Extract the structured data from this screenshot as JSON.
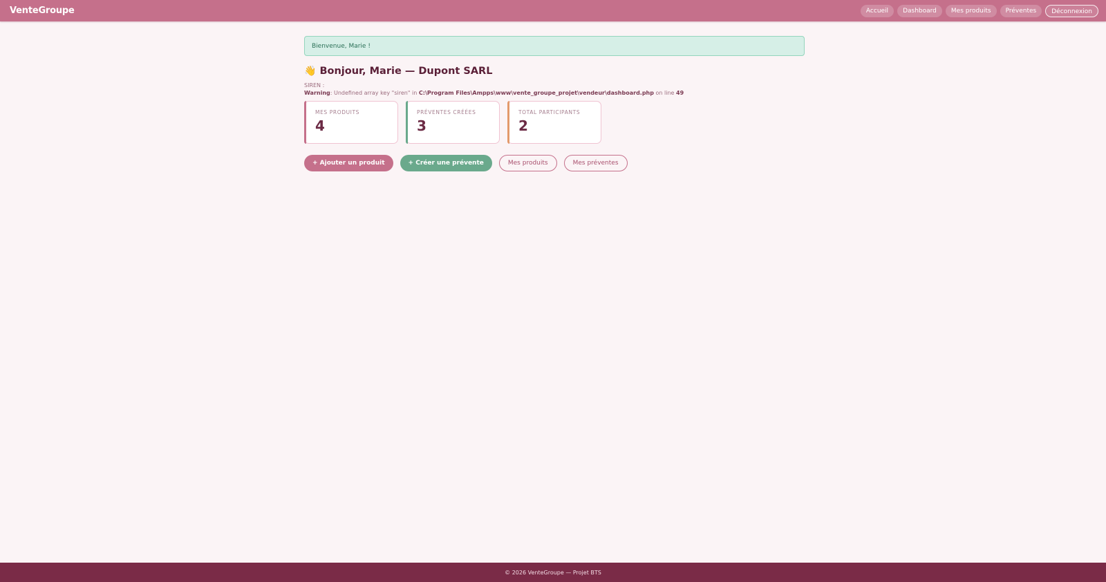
{
  "header": {
    "brand": "VenteGroupe",
    "nav": [
      "Accueil",
      "Dashboard",
      "Mes produits",
      "Préventes"
    ],
    "logout": "Déconnexion"
  },
  "flash": "Bienvenue, Marie !",
  "greeting": {
    "icon": "waving-hand-icon",
    "emoji": "👋",
    "text": "Bonjour, Marie — Dupont SARL"
  },
  "siren_label": "SIREN :",
  "warning": {
    "label": "Warning",
    "message": ": Undefined array key \"siren\" in ",
    "file": "C:\\Program Files\\Ampps\\www\\vente_groupe_projet\\vendeur\\dashboard.php",
    "on_line": " on line ",
    "line": "49"
  },
  "stats": [
    {
      "label": "MES PRODUITS",
      "value": "4",
      "accent": "#c5708b"
    },
    {
      "label": "PRÉVENTES CRÉÉES",
      "value": "3",
      "accent": "#6aa98c"
    },
    {
      "label": "TOTAL PARTICIPANTS",
      "value": "2",
      "accent": "#e39a6b"
    }
  ],
  "actions": {
    "add_product": "+ Ajouter un produit",
    "create_presale": "+ Créer une prévente",
    "my_products": "Mes produits",
    "my_presales": "Mes préventes"
  },
  "footer": "© 2026 VenteGroupe — Projet BTS"
}
